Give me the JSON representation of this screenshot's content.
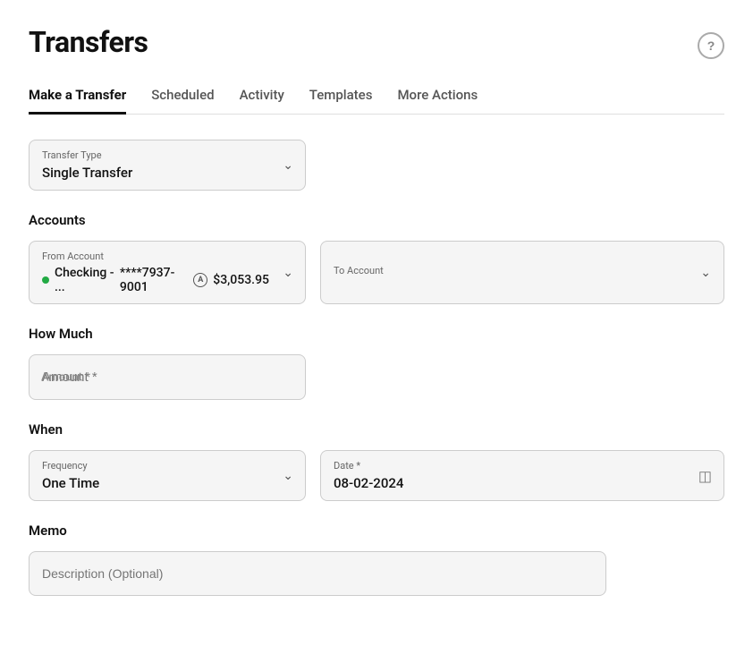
{
  "page": {
    "title": "Transfers",
    "help_icon_label": "?"
  },
  "tabs": [
    {
      "id": "make-a-transfer",
      "label": "Make a Transfer",
      "active": true
    },
    {
      "id": "scheduled",
      "label": "Scheduled",
      "active": false
    },
    {
      "id": "activity",
      "label": "Activity",
      "active": false
    },
    {
      "id": "templates",
      "label": "Templates",
      "active": false
    },
    {
      "id": "more-actions",
      "label": "More Actions",
      "active": false
    }
  ],
  "transfer_type": {
    "field_label": "Transfer Type",
    "value": "Single Transfer"
  },
  "accounts_section": {
    "label": "Accounts",
    "from_account": {
      "field_label": "From Account",
      "account_name": "Checking - ...",
      "account_number": "****7937-9001",
      "balance": "$3,053.95"
    },
    "to_account": {
      "field_label": "To Account",
      "value": ""
    }
  },
  "how_much_section": {
    "label": "How Much",
    "amount_field": {
      "placeholder": "Amount *",
      "value": ""
    }
  },
  "when_section": {
    "label": "When",
    "frequency": {
      "field_label": "Frequency",
      "value": "One Time"
    },
    "date": {
      "field_label": "Date *",
      "value": "08-02-2024"
    }
  },
  "memo_section": {
    "label": "Memo",
    "description_field": {
      "placeholder": "Description (Optional)",
      "value": ""
    }
  }
}
